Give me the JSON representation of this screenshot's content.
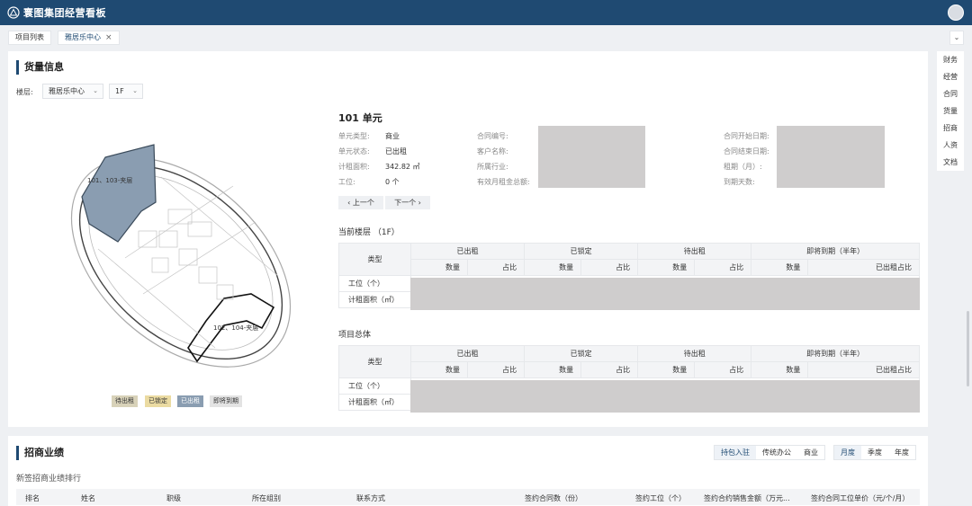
{
  "app": {
    "title": "寰图集团经营看板"
  },
  "tabs": [
    {
      "label": "项目列表"
    },
    {
      "label": "雅居乐中心",
      "active": true
    }
  ],
  "right_nav": [
    "财务",
    "经营",
    "合同",
    "货量",
    "招商",
    "人资",
    "文档"
  ],
  "goods": {
    "section_title": "货量信息",
    "floor_label": "楼层:",
    "project_select": "雅居乐中心",
    "floor_select": "1F",
    "plan_labels": {
      "zone_a": "101、103-夹层",
      "zone_b": "102、104-夹层"
    },
    "legend": [
      {
        "label": "待出租",
        "color": "#d8d2b9"
      },
      {
        "label": "已锁定",
        "color": "#ebdba2"
      },
      {
        "label": "已出租",
        "color": "#8a9db1"
      },
      {
        "label": "即将到期",
        "color": "#e3e3e3"
      }
    ],
    "unit": {
      "title": "101 单元",
      "type_label": "单元类型:",
      "type_value": "商业",
      "status_label": "单元状态:",
      "status_value": "已出租",
      "area_label": "计租面积:",
      "area_value": "342.82 ㎡",
      "seats_label": "工位:",
      "seats_value": "0 个",
      "contract_no_label": "合同编号:",
      "customer_label": "客户名称:",
      "industry_label": "所属行业:",
      "rent_total_label": "有效月租金总额:",
      "start_label": "合同开始日期:",
      "end_label": "合同结束日期:",
      "term_label": "租期（月）:",
      "days_label": "到期天数:",
      "prev": "‹ 上一个",
      "next": "下一个 ›"
    },
    "current_floor_title": "当前楼层 （1F）",
    "project_total_title": "项目总体",
    "table_header": {
      "type": "类型",
      "groups": [
        "已出租",
        "已锁定",
        "待出租",
        "即将到期（半年）"
      ],
      "sub": [
        "数量",
        "占比",
        "数量",
        "占比",
        "数量",
        "占比",
        "数量",
        "已出租占比"
      ]
    },
    "table_rows": [
      "工位（个）",
      "计租面积（㎡）"
    ]
  },
  "performance": {
    "section_title": "招商业绩",
    "type_buttons": [
      "持包入驻",
      "传统办公",
      "商业"
    ],
    "period_buttons": [
      "月度",
      "季度",
      "年度"
    ],
    "rank_title": "新签招商业绩排行",
    "columns": [
      "排名",
      "姓名",
      "职级",
      "所在组别",
      "联系方式",
      "签约合同数（份）",
      "签约工位（个）",
      "签约合约销售金额（万元...",
      "签约合同工位单价（元/个/月）"
    ]
  }
}
